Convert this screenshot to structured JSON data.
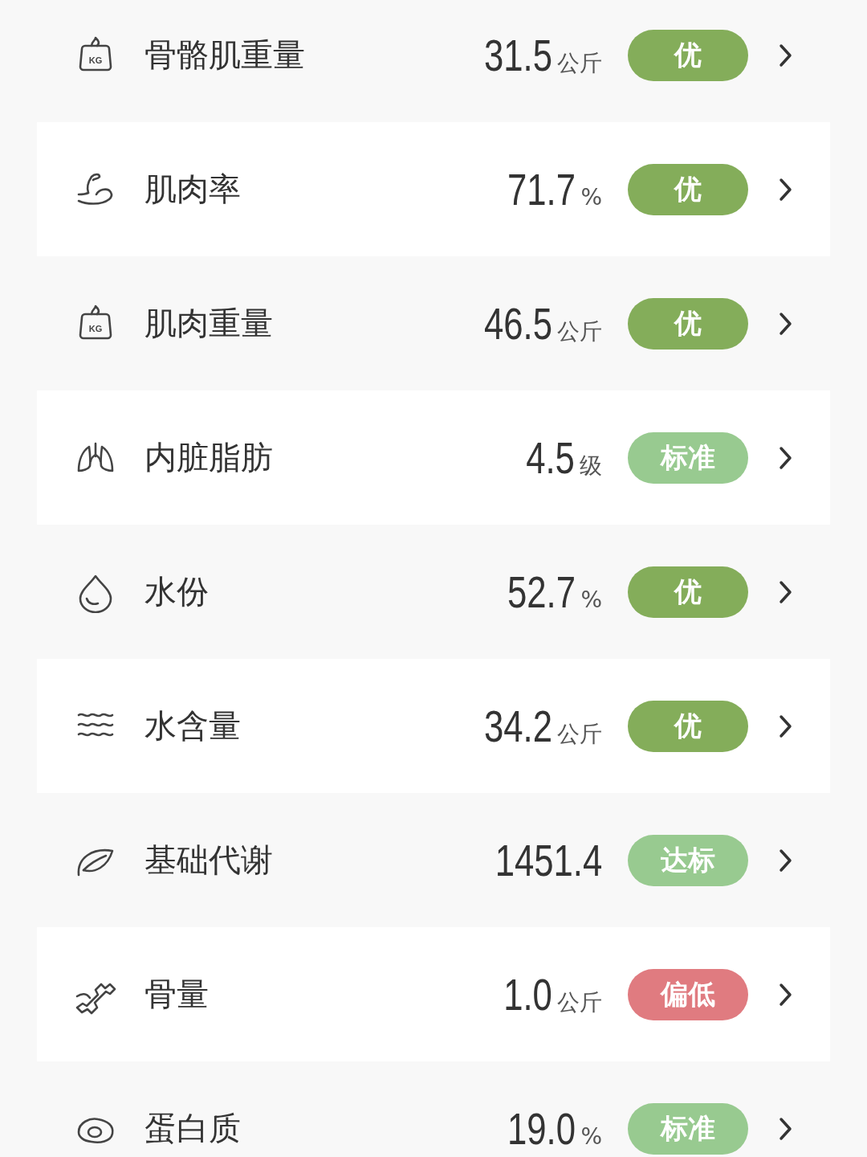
{
  "metrics": [
    {
      "kind": "weight",
      "icon_text": "KG",
      "label": "骨骼肌重量",
      "value": "31.5",
      "unit": "公斤",
      "badge": "优",
      "color": "#84ad5a"
    },
    {
      "kind": "muscle",
      "label": "肌肉率",
      "value": "71.7",
      "unit": "%",
      "badge": "优",
      "color": "#84ad5a"
    },
    {
      "kind": "weight",
      "icon_text": "KG",
      "label": "肌肉重量",
      "value": "46.5",
      "unit": "公斤",
      "badge": "优",
      "color": "#84ad5a"
    },
    {
      "kind": "lungs",
      "label": "内脏脂肪",
      "value": "4.5",
      "unit": "级",
      "badge": "标准",
      "color": "#98ca90"
    },
    {
      "kind": "drop",
      "label": "水份",
      "value": "52.7",
      "unit": "%",
      "badge": "优",
      "color": "#84ad5a"
    },
    {
      "kind": "waves",
      "label": "水含量",
      "value": "34.2",
      "unit": "公斤",
      "badge": "优",
      "color": "#84ad5a"
    },
    {
      "kind": "leaf",
      "label": "基础代谢",
      "value": "1451.4",
      "badge": "达标",
      "color": "#98ca90"
    },
    {
      "kind": "bone",
      "label": "骨量",
      "value": "1.0",
      "unit": "公斤",
      "badge": "偏低",
      "color": "#e07b80"
    },
    {
      "kind": "egg",
      "label": "蛋白质",
      "value": "19.0",
      "unit": "%",
      "badge": "标准",
      "color": "#98ca90"
    }
  ]
}
